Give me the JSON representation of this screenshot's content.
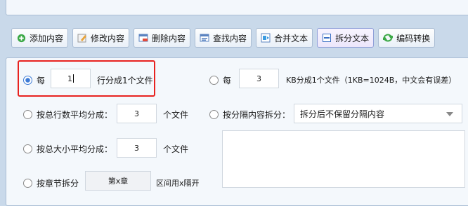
{
  "toolbar": {
    "buttons": [
      {
        "label": "添加内容",
        "icon": "add-icon"
      },
      {
        "label": "修改内容",
        "icon": "edit-icon"
      },
      {
        "label": "删除内容",
        "icon": "delete-icon"
      },
      {
        "label": "查找内容",
        "icon": "find-icon"
      },
      {
        "label": "合并文本",
        "icon": "merge-icon"
      },
      {
        "label": "拆分文本",
        "icon": "split-icon",
        "active": true
      },
      {
        "label": "编码转换",
        "icon": "convert-icon"
      }
    ]
  },
  "options": {
    "by_lines": {
      "prefix": "每",
      "value": "1",
      "suffix": "行分成1个文件",
      "checked": true
    },
    "by_kb": {
      "prefix": "每",
      "value": "3",
      "suffix": "KB分成1个文件（1KB=1024B，中文会有误差）"
    },
    "by_total_lines": {
      "label": "按总行数平均分成：",
      "value": "3",
      "suffix": "个文件"
    },
    "by_delimiter": {
      "label": "按分隔内容拆分：",
      "selected": "拆分后不保留分隔内容"
    },
    "by_total_size": {
      "label": "按总大小平均分成：",
      "value": "3",
      "suffix": "个文件"
    },
    "by_chapter": {
      "label": "按章节拆分",
      "value": "第x章",
      "suffix": "区间用x隔开"
    }
  },
  "colors": {
    "accent": "#3d7bd6",
    "highlight": "#e8221f",
    "background": "#c9d9ea"
  }
}
